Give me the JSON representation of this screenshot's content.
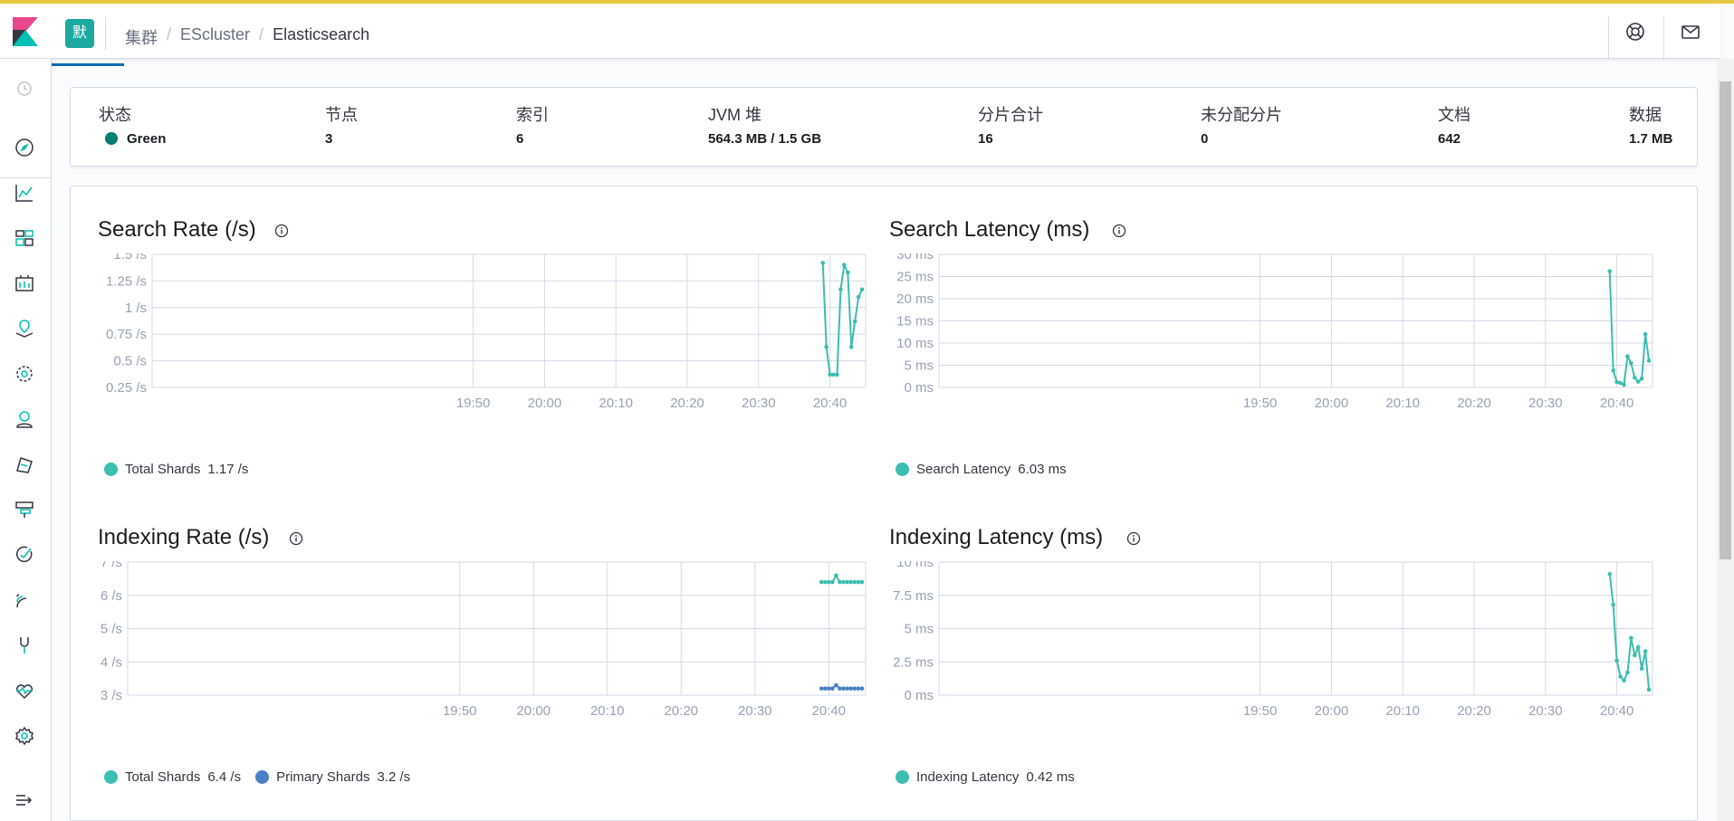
{
  "colors": {
    "accent": "#006bb4",
    "series_teal": "#3cbeb0",
    "series_blue": "#4a7fc1",
    "status_green": "#017d73",
    "space_badge": "#1ba9a0"
  },
  "header": {
    "space_initial": "默",
    "breadcrumbs": [
      "集群",
      "EScluster",
      "Elasticsearch"
    ],
    "icons": [
      "help-lifebuoy-icon",
      "mail-icon"
    ]
  },
  "sidebar": {
    "icons": [
      "recent-clock-icon",
      "discover-compass-icon",
      "visualize-chart-icon",
      "dashboard-icon",
      "canvas-icon",
      "maps-icon",
      "ml-icon",
      "infrastructure-icon",
      "logs-icon",
      "apm-icon",
      "uptime-icon",
      "siem-icon",
      "dev-tools-icon",
      "monitoring-icon",
      "management-gear-icon",
      "collapse-menu-icon"
    ]
  },
  "summary": {
    "stats": [
      {
        "label": "状态",
        "value": "Green"
      },
      {
        "label": "节点",
        "value": "3"
      },
      {
        "label": "索引",
        "value": "6"
      },
      {
        "label": "JVM 堆",
        "value": "564.3 MB / 1.5 GB"
      },
      {
        "label": "分片合计",
        "value": "16"
      },
      {
        "label": "未分配分片",
        "value": "0"
      },
      {
        "label": "文档",
        "value": "642"
      },
      {
        "label": "数据",
        "value": "1.7 MB"
      }
    ]
  },
  "chart_data": [
    {
      "type": "line",
      "title": "Search Rate (/s)",
      "x_ticks": [
        "19:50",
        "20:00",
        "20:10",
        "20:20",
        "20:30",
        "20:40"
      ],
      "y_ticks": [
        "0.25 /s",
        "0.5 /s",
        "0.75 /s",
        "1 /s",
        "1.25 /s",
        "1.5 /s"
      ],
      "ylim": [
        0.25,
        1.5
      ],
      "x_minutes": [
        39.0,
        39.5,
        40.0,
        40.5,
        41.0,
        41.5,
        42.0,
        42.5,
        43.0,
        43.5,
        44.0,
        44.5
      ],
      "series": [
        {
          "name": "Total Shards",
          "color": "#3cbeb0",
          "values": [
            1.42,
            0.63,
            0.37,
            0.37,
            0.37,
            1.17,
            1.4,
            1.33,
            0.63,
            0.87,
            1.1,
            1.17
          ]
        }
      ],
      "legend": [
        {
          "name": "Total Shards",
          "value": "1.17 /s"
        }
      ]
    },
    {
      "type": "line",
      "title": "Search Latency (ms)",
      "x_ticks": [
        "19:50",
        "20:00",
        "20:10",
        "20:20",
        "20:30",
        "20:40"
      ],
      "y_ticks": [
        "0 ms",
        "5 ms",
        "10 ms",
        "15 ms",
        "20 ms",
        "25 ms",
        "30 ms"
      ],
      "ylim": [
        0,
        30
      ],
      "x_minutes": [
        39.0,
        39.5,
        40.0,
        40.5,
        41.0,
        41.5,
        42.0,
        42.5,
        43.0,
        43.5,
        44.0,
        44.5
      ],
      "series": [
        {
          "name": "Search Latency",
          "color": "#3cbeb0",
          "values": [
            26.2,
            3.8,
            1.2,
            1.0,
            0.6,
            7.0,
            5.5,
            2.2,
            1.3,
            2.0,
            12.0,
            6.03
          ]
        }
      ],
      "legend": [
        {
          "name": "Search Latency",
          "value": "6.03 ms"
        }
      ]
    },
    {
      "type": "line",
      "title": "Indexing Rate (/s)",
      "x_ticks": [
        "19:50",
        "20:00",
        "20:10",
        "20:20",
        "20:30",
        "20:40"
      ],
      "y_ticks": [
        "3 /s",
        "4 /s",
        "5 /s",
        "6 /s",
        "7 /s"
      ],
      "ylim": [
        3,
        7
      ],
      "x_minutes": [
        39.0,
        39.5,
        40.0,
        40.5,
        41.0,
        41.5,
        42.0,
        42.5,
        43.0,
        43.5,
        44.0,
        44.5
      ],
      "series": [
        {
          "name": "Total Shards",
          "color": "#3cbeb0",
          "values": [
            6.4,
            6.4,
            6.4,
            6.4,
            6.6,
            6.4,
            6.4,
            6.4,
            6.4,
            6.4,
            6.4,
            6.4
          ]
        },
        {
          "name": "Primary Shards",
          "color": "#4a7fc1",
          "values": [
            3.2,
            3.2,
            3.2,
            3.2,
            3.3,
            3.2,
            3.2,
            3.2,
            3.2,
            3.2,
            3.2,
            3.2
          ]
        }
      ],
      "legend": [
        {
          "name": "Total Shards",
          "value": "6.4 /s"
        },
        {
          "name": "Primary Shards",
          "value": "3.2 /s"
        }
      ]
    },
    {
      "type": "line",
      "title": "Indexing Latency (ms)",
      "x_ticks": [
        "19:50",
        "20:00",
        "20:10",
        "20:20",
        "20:30",
        "20:40"
      ],
      "y_ticks": [
        "0 ms",
        "2.5 ms",
        "5 ms",
        "7.5 ms",
        "10 ms"
      ],
      "ylim": [
        0,
        10
      ],
      "x_minutes": [
        39.0,
        39.5,
        40.0,
        40.5,
        41.0,
        41.5,
        42.0,
        42.5,
        43.0,
        43.5,
        44.0,
        44.5
      ],
      "series": [
        {
          "name": "Indexing Latency",
          "color": "#3cbeb0",
          "values": [
            9.1,
            6.8,
            2.6,
            1.4,
            1.1,
            1.7,
            4.3,
            3.0,
            3.6,
            2.0,
            3.3,
            0.42
          ]
        }
      ],
      "legend": [
        {
          "name": "Indexing Latency",
          "value": "0.42 ms"
        }
      ]
    }
  ]
}
